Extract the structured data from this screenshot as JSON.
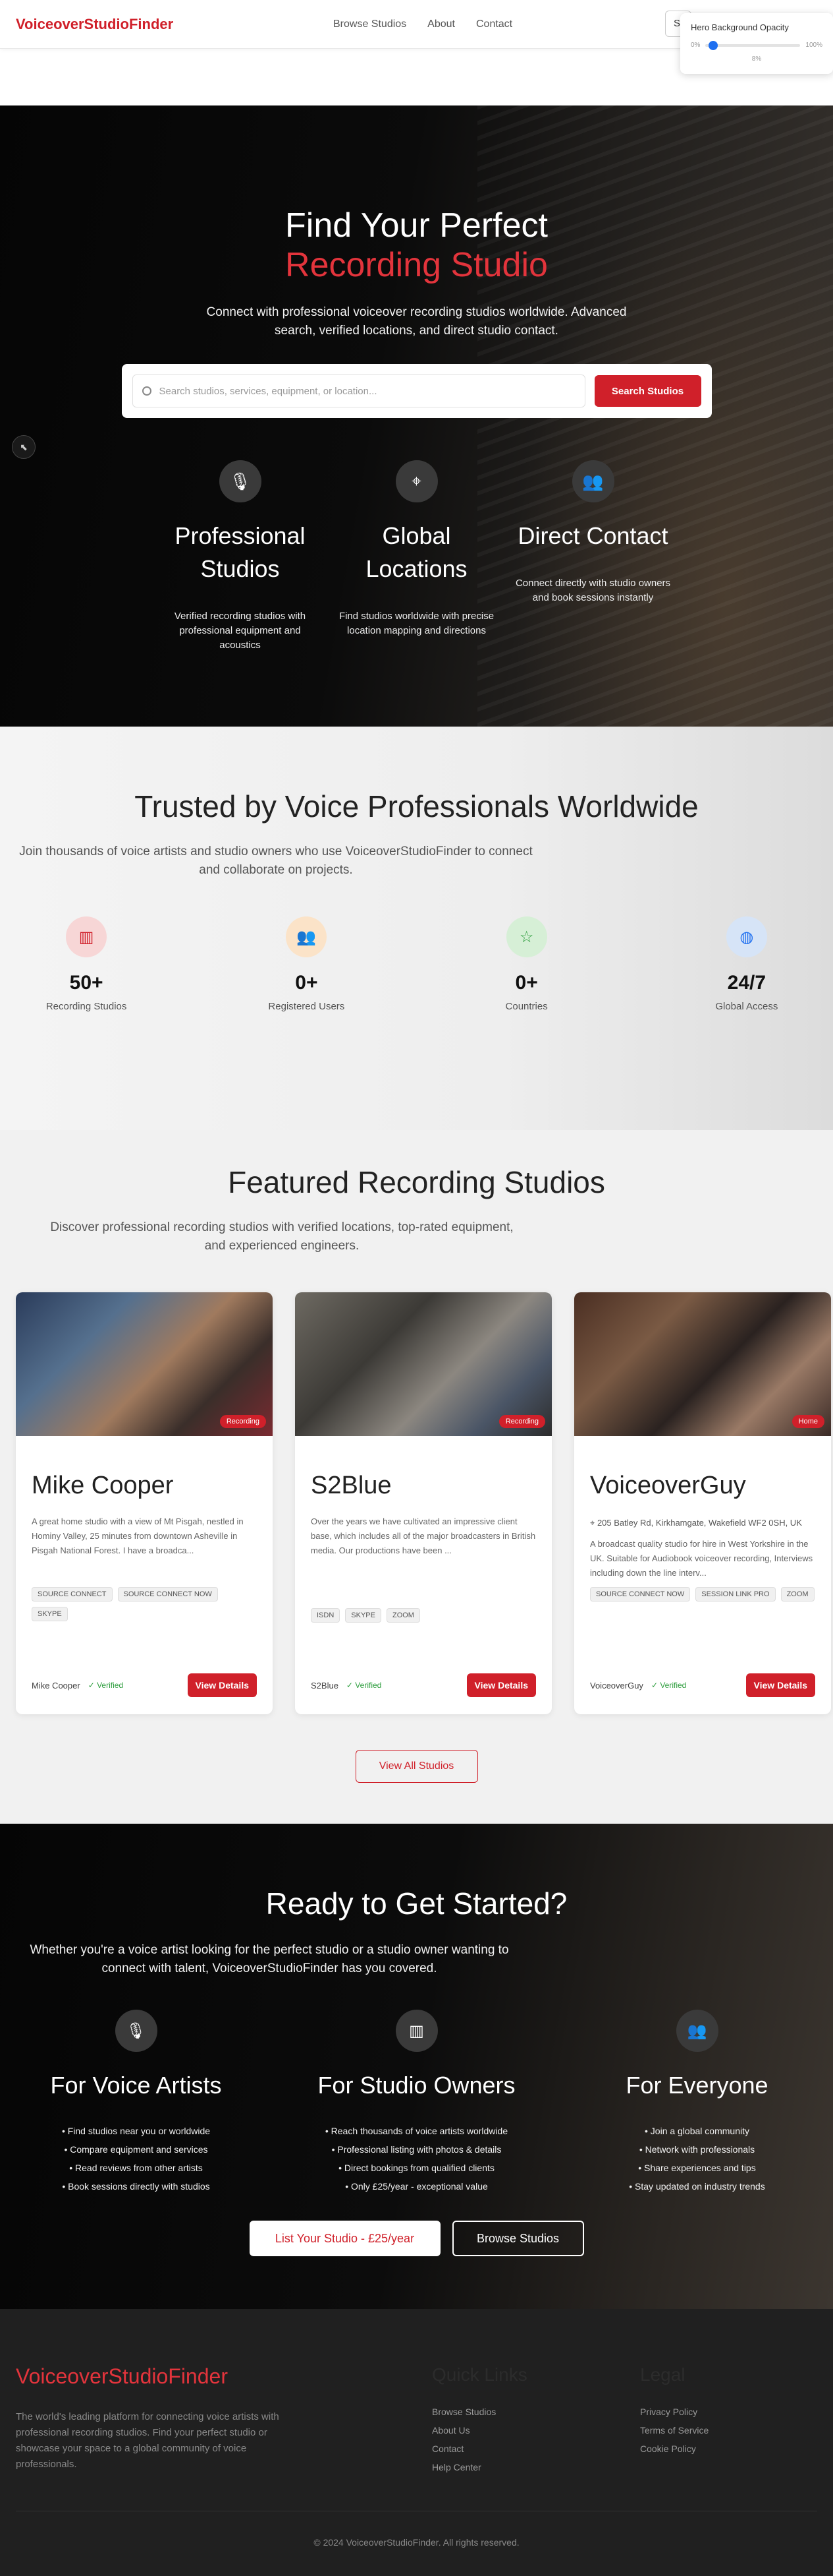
{
  "nav": {
    "logo": "VoiceoverStudioFinder",
    "links": [
      "Browse Studios",
      "About",
      "Contact"
    ],
    "sign_letter": "S"
  },
  "opacity_panel": {
    "title": "Hero Background Opacity",
    "min_label": "0%",
    "max_label": "100%",
    "value_label": "8%",
    "value": 0.08
  },
  "hero": {
    "title_line1": "Find Your Perfect",
    "title_line2": "Recording Studio",
    "subtitle": "Connect with professional voiceover recording studios worldwide. Advanced search, verified locations, and direct studio contact.",
    "search_placeholder": "Search studios, services, equipment, or location...",
    "search_button": "Search Studios",
    "features": [
      {
        "icon": "microphone-icon",
        "title": "Professional Studios",
        "text": "Verified recording studios with professional equipment and acoustics"
      },
      {
        "icon": "location-pin-icon",
        "title": "Global Locations",
        "text": "Find studios worldwide with precise location mapping and directions"
      },
      {
        "icon": "users-icon",
        "title": "Direct Contact",
        "text": "Connect directly with studio owners and book sessions instantly"
      }
    ]
  },
  "trust": {
    "title": "Trusted by Voice Professionals Worldwide",
    "subtitle": "Join thousands of voice artists and studio owners who use VoiceoverStudioFinder to connect and collaborate on projects.",
    "stats": [
      {
        "icon": "building-icon",
        "value": "50+",
        "label": "Recording Studios",
        "bg": "#f7d6d6",
        "fg": "#d0202a"
      },
      {
        "icon": "users-icon",
        "value": "0+",
        "label": "Registered Users",
        "bg": "#fbe3c8",
        "fg": "#e08a1e"
      },
      {
        "icon": "star-icon",
        "value": "0+",
        "label": "Countries",
        "bg": "#d6efd6",
        "fg": "#2e9e3e"
      },
      {
        "icon": "globe-icon",
        "value": "24/7",
        "label": "Global Access",
        "bg": "#d6e4f7",
        "fg": "#1e6ff0"
      }
    ]
  },
  "featured": {
    "title": "Featured Recording Studios",
    "subtitle": "Discover professional recording studios with verified locations, top-rated equipment, and experienced engineers.",
    "view_all": "View All Studios",
    "studios": [
      {
        "name": "Mike Cooper",
        "badge": "Recording",
        "location": "",
        "description": "A great home studio with a view of Mt Pisgah, nestled in Hominy Valley, 25 minutes from downtown Asheville in Pisgah National Forest. I have a broadca...",
        "tags": [
          "SOURCE CONNECT",
          "SOURCE CONNECT NOW",
          "SKYPE"
        ],
        "owner": "Mike Cooper",
        "verified": "✓ Verified",
        "button": "View Details"
      },
      {
        "name": "S2Blue",
        "badge": "Recording",
        "location": "",
        "description": "Over the years we have cultivated an impressive client base, which includes all of the major broadcasters in British media. Our productions have been ...",
        "tags": [
          "ISDN",
          "SKYPE",
          "ZOOM"
        ],
        "owner": "S2Blue",
        "verified": "✓ Verified",
        "button": "View Details"
      },
      {
        "name": "VoiceoverGuy",
        "badge": "Home",
        "location": "205 Batley Rd, Kirkhamgate, Wakefield WF2 0SH, UK",
        "description": "A broadcast quality studio for hire in West Yorkshire in the UK. Suitable for Audiobook voiceover recording, Interviews including down the line interv...",
        "tags": [
          "SOURCE CONNECT NOW",
          "SESSION LINK PRO",
          "ZOOM"
        ],
        "owner": "VoiceoverGuy",
        "verified": "✓ Verified",
        "button": "View Details"
      }
    ]
  },
  "cta": {
    "title": "Ready to Get Started?",
    "subtitle": "Whether you're a voice artist looking for the perfect studio or a studio owner wanting to connect with talent, VoiceoverStudioFinder has you covered.",
    "paths": [
      {
        "icon": "microphone-icon",
        "title": "For Voice Artists",
        "items": [
          "• Find studios near you or worldwide",
          "• Compare equipment and services",
          "• Read reviews from other artists",
          "• Book sessions directly with studios"
        ]
      },
      {
        "icon": "building-icon",
        "title": "For Studio Owners",
        "items": [
          "• Reach thousands of voice artists worldwide",
          "• Professional listing with photos & details",
          "• Direct bookings from qualified clients",
          "• Only £25/year - exceptional value"
        ]
      },
      {
        "icon": "users-icon",
        "title": "For Everyone",
        "items": [
          "• Join a global community",
          "• Network with professionals",
          "• Share experiences and tips",
          "• Stay updated on industry trends"
        ]
      }
    ],
    "primary_button": "List Your Studio - £25/year",
    "secondary_button": "Browse Studios"
  },
  "footer": {
    "logo": "VoiceoverStudioFinder",
    "description": "The world's leading platform for connecting voice artists with professional recording studios. Find your perfect studio or showcase your space to a global community of voice professionals.",
    "quick_links_title": "Quick Links",
    "quick_links": [
      "Browse Studios",
      "About Us",
      "Contact",
      "Help Center"
    ],
    "legal_title": "Legal",
    "legal_links": [
      "Privacy Policy",
      "Terms of Service",
      "Cookie Policy"
    ],
    "copyright": "© 2024 VoiceoverStudioFinder. All rights reserved."
  }
}
